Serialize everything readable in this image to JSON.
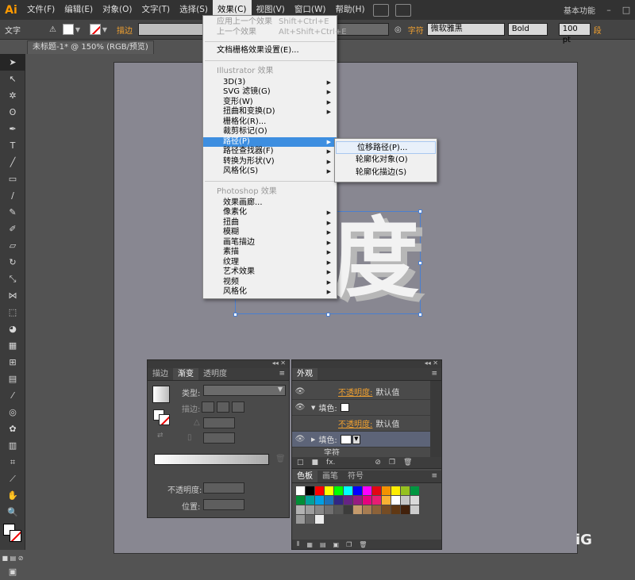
{
  "app": {
    "logo": "Ai",
    "menus": [
      "文件(F)",
      "编辑(E)",
      "对象(O)",
      "文字(T)",
      "选择(S)",
      "效果(C)",
      "视图(V)",
      "窗口(W)",
      "帮助(H)"
    ],
    "active_menu_index": 5,
    "workspace": "基本功能"
  },
  "controlbar": {
    "type_label": "文字",
    "stroke_label": "描边",
    "char_label": "字符",
    "font_name": "微软雅黑",
    "font_weight": "Bold",
    "font_size": "100 pt",
    "paragraph_label": "段"
  },
  "document": {
    "tab_title": "未标题-1* @ 150% (RGB/预览)",
    "big_text": "度",
    "corner_text": "iG"
  },
  "effect_menu": {
    "apply_last": "应用上一个效果",
    "apply_last_shortcut": "Shift+Ctrl+E",
    "last_effect": "上一个效果",
    "last_effect_shortcut": "Alt+Shift+Ctrl+E",
    "raster_settings": "文档栅格效果设置(E)...",
    "illustrator_header": "Illustrator 效果",
    "illustrator_items": [
      {
        "label": "3D(3)",
        "sub": true
      },
      {
        "label": "SVG 滤镜(G)",
        "sub": true
      },
      {
        "label": "变形(W)",
        "sub": true
      },
      {
        "label": "扭曲和变换(D)",
        "sub": true
      },
      {
        "label": "栅格化(R)...",
        "sub": false
      },
      {
        "label": "裁剪标记(O)",
        "sub": false
      },
      {
        "label": "路径(P)",
        "sub": true
      },
      {
        "label": "路径查找器(F)",
        "sub": true
      },
      {
        "label": "转换为形状(V)",
        "sub": true
      },
      {
        "label": "风格化(S)",
        "sub": true
      }
    ],
    "highlighted_index": 6,
    "photoshop_header": "Photoshop 效果",
    "photoshop_items": [
      {
        "label": "效果画廊...",
        "sub": false
      },
      {
        "label": "像素化",
        "sub": true
      },
      {
        "label": "扭曲",
        "sub": true
      },
      {
        "label": "模糊",
        "sub": true
      },
      {
        "label": "画笔描边",
        "sub": true
      },
      {
        "label": "素描",
        "sub": true
      },
      {
        "label": "纹理",
        "sub": true
      },
      {
        "label": "艺术效果",
        "sub": true
      },
      {
        "label": "视频",
        "sub": true
      },
      {
        "label": "风格化",
        "sub": true
      }
    ]
  },
  "path_submenu": {
    "items": [
      "位移路径(P)...",
      "轮廓化对象(O)",
      "轮廓化描边(S)"
    ]
  },
  "gradient_panel": {
    "tabs": [
      "描边",
      "渐变",
      "透明度"
    ],
    "active_tab": 1,
    "type_label": "类型:",
    "stroke_label": "描边:",
    "opacity_label": "不透明度:",
    "position_label": "位置:"
  },
  "appearance_panel": {
    "title": "外观",
    "rows": [
      {
        "label": "不透明度:",
        "value": "默认值",
        "kind": "opacity"
      },
      {
        "label": "填色:",
        "value": "",
        "kind": "fill"
      },
      {
        "label": "不透明度:",
        "value": "默认值",
        "kind": "opacity"
      },
      {
        "label": "填色:",
        "value": "",
        "kind": "fill-selected"
      },
      {
        "label": "字符",
        "value": "",
        "kind": "text"
      }
    ]
  },
  "swatch_panel": {
    "tabs": [
      "色板",
      "画笔",
      "符号"
    ],
    "active_tab": 0,
    "colors": [
      "#ffffff",
      "#000000",
      "#ff0000",
      "#ffff00",
      "#00ff00",
      "#00ffff",
      "#0000ff",
      "#ff00ff",
      "#e30613",
      "#f39200",
      "#ffed00",
      "#95c11f",
      "#009640",
      "#008d36",
      "#00a19a",
      "#009fe3",
      "#1d71b8",
      "#312783",
      "#662483",
      "#951b81",
      "#e6007e",
      "#e71d73",
      "#f8b133",
      "#fff",
      "#c6c6c6",
      "#dadada",
      "#b2b2b2",
      "#9d9d9d",
      "#878787",
      "#706f6f",
      "#575756",
      "#3c3c3b",
      "#c49a6c",
      "#a67c52",
      "#8c6239",
      "#754c24",
      "#603813",
      "#42210b",
      "#ccc",
      "#999",
      "#666",
      "#ededed"
    ]
  }
}
